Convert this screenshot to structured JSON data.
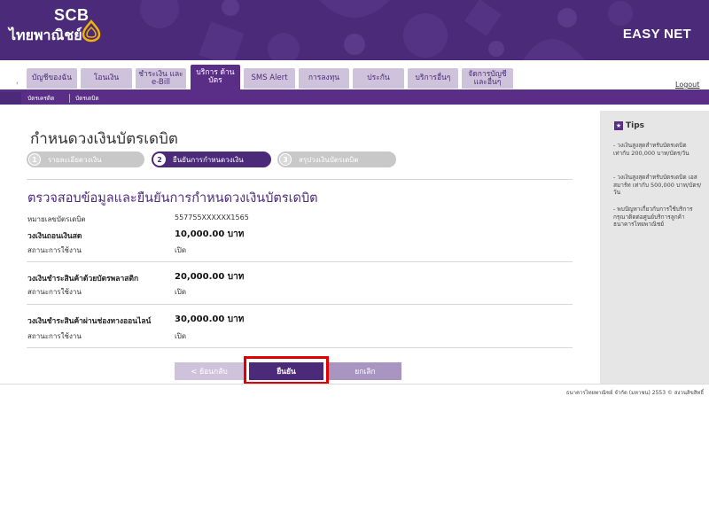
{
  "header": {
    "logo_en": "SCB",
    "logo_th": "ไทยพาณิชย์",
    "product": "EASY NET"
  },
  "tabs": [
    {
      "label": "บัญชีของฉัน",
      "active": false
    },
    {
      "label": "โอนเงิน",
      "active": false
    },
    {
      "label": "ชำระเงิน และ e-Bill",
      "active": false
    },
    {
      "label": "บริการ ด้านบัตร",
      "active": true
    },
    {
      "label": "SMS Alert",
      "active": false
    },
    {
      "label": "การลงทุน",
      "active": false
    },
    {
      "label": "ประกัน",
      "active": false
    },
    {
      "label": "บริการอื่นๆ",
      "active": false
    },
    {
      "label": "จัดการบัญชี และอื่นๆ",
      "active": false
    }
  ],
  "logout_label": "Logout",
  "subtabs": [
    "บัตรเครดิต",
    "บัตรเดบิต"
  ],
  "page_title": "กำหนดวงเงินบัตรเดบิต",
  "steps": [
    {
      "num": "1",
      "label": "รายละเอียดวงเงิน",
      "state": "inactive"
    },
    {
      "num": "2",
      "label": "ยืนยันการกำหนดวงเงิน",
      "state": "active"
    },
    {
      "num": "3",
      "label": "สรุปวงเงินบัตรเดบิต",
      "state": "inactive"
    }
  ],
  "section_title": "ตรวจสอบข้อมูลและยืนยันการกำหนดวงเงินบัตรเดบิต",
  "card_number_label": "หมายเลขบัตรเดบิต",
  "card_number": "557755XXXXXX1565",
  "limits": [
    {
      "label": "วงเงินถอนเงินสด",
      "amount": "10,000.00 บาท",
      "status_label": "สถานะการใช้งาน",
      "status": "เปิด"
    },
    {
      "label": "วงเงินชำระสินค้าด้วยบัตรพลาสติก",
      "amount": "20,000.00 บาท",
      "status_label": "สถานะการใช้งาน",
      "status": "เปิด"
    },
    {
      "label": "วงเงินชำระสินค้าผ่านช่องทางออนไลน์",
      "amount": "30,000.00 บาท",
      "status_label": "สถานะการใช้งาน",
      "status": "เปิด"
    }
  ],
  "buttons": {
    "back": "< ย้อนกลับ",
    "confirm": "ยืนยัน",
    "cancel": "ยกเลิก"
  },
  "footer": "ธนาคารไทยพาณิชย์ จำกัด (มหาชน) 2553 © สงวนลิขสิทธิ์",
  "tips": {
    "title": "Tips",
    "items": [
      "- วงเงินสูงสุดสำหรับบัตรเดบิต เท่ากับ 200,000 บาท/บัตร/วัน",
      "- วงเงินสูงสุดสำหรับบัตรเดบิต เอส สมาร์ท เท่ากับ 500,000 บาท/บัตร/วัน",
      "- พบปัญหาเกี่ยวกับการใช้บริการ กรุณาติดต่อศูนย์บริการลูกค้า ธนาคารไทยพาณิชย์"
    ]
  },
  "colors": {
    "brand_purple": "#4b2a7a",
    "tab_inactive": "#cfc3db",
    "highlight": "#e00000"
  }
}
